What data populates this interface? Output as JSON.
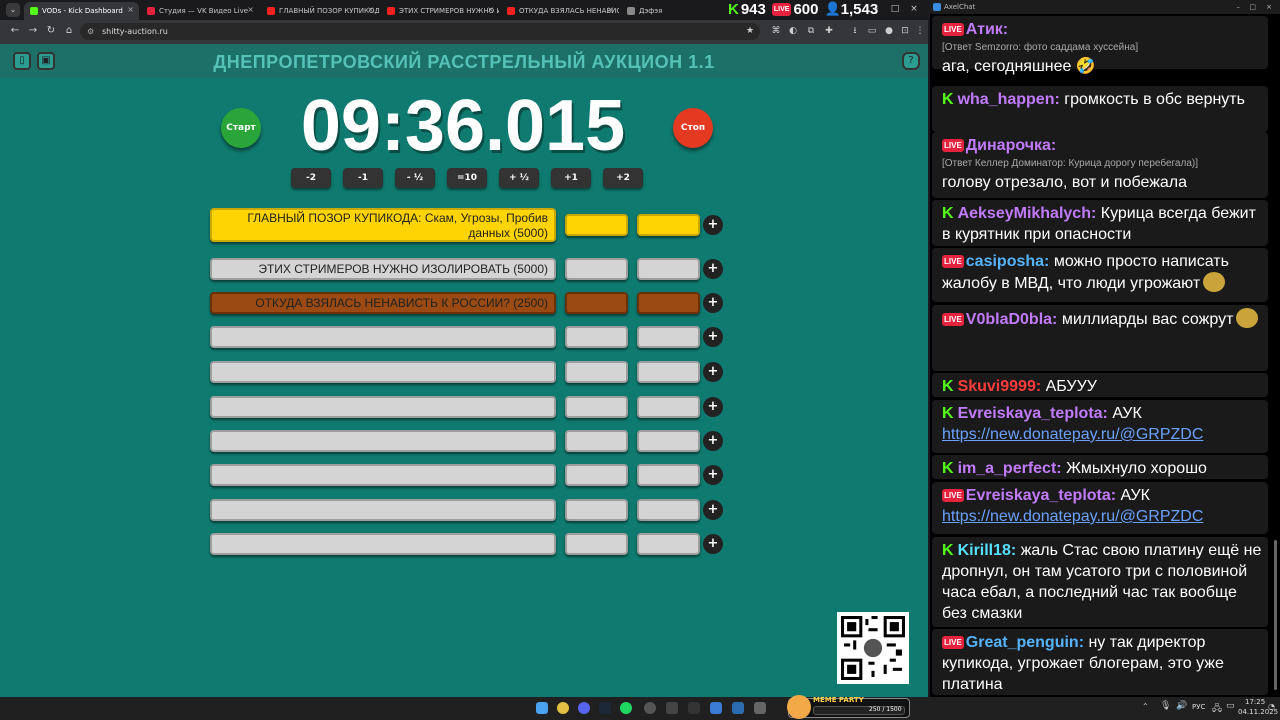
{
  "browser": {
    "tabs": [
      {
        "label": "VODs - Kick Dashboard",
        "color": "#53fc18"
      },
      {
        "label": "Студия — VK Видео Live",
        "color": "#e5233e"
      },
      {
        "label": "ГЛАВНЫЙ ПОЗОР КУПИКОДА: Ск",
        "color": "#ff2020"
      },
      {
        "label": "ЭТИХ СТРИМЕРОВ НУЖНО ИЗ",
        "color": "#ff2020"
      },
      {
        "label": "ОТКУДА ВЗЯЛАСЬ НЕНАВИСТЬ",
        "color": "#ff2020"
      },
      {
        "label": "Дэфэя",
        "color": "#888888"
      }
    ],
    "url": "shitty-auction.ru"
  },
  "overlay": {
    "kick_count": "943",
    "vk_count": "600",
    "viewers": "1,543",
    "vk_badge": "LIVE"
  },
  "auction": {
    "title": "ДНЕПРОПЕТРОВСКИЙ РАССТРЕЛЬНЫЙ АУКЦИОН 1.1",
    "timer": "09:36.015",
    "start_label": "Старт",
    "stop_label": "Стоп",
    "adjust_buttons": [
      "-2",
      "-1",
      "- ½",
      "=10",
      "+ ½",
      "+1",
      "+2"
    ],
    "lots": [
      {
        "text": "ГЛАВНЫЙ ПОЗОР КУПИКОДА: Скам, Угрозы, Пробив данных (5000)",
        "color": "#ffd400"
      },
      {
        "text": "ЭТИХ СТРИМЕРОВ НУЖНО ИЗОЛИРОВАТЬ (5000)",
        "color": "#d4d4d4"
      },
      {
        "text": "ОТКУДА ВЗЯЛАСЬ НЕНАВИСТЬ К РОССИИ? (2500)",
        "color": "#9a4a12"
      },
      {
        "text": "",
        "color": "#d4d4d4"
      },
      {
        "text": "",
        "color": "#d4d4d4"
      },
      {
        "text": "",
        "color": "#d4d4d4"
      },
      {
        "text": "",
        "color": "#d4d4d4"
      },
      {
        "text": "",
        "color": "#d4d4d4"
      },
      {
        "text": "",
        "color": "#d4d4d4"
      },
      {
        "text": "",
        "color": "#d4d4d4"
      }
    ],
    "plus_label": "+"
  },
  "chat": {
    "title": "AxelChat",
    "messages": [
      {
        "platform": "vk",
        "name": "Атик:",
        "color": "#c27bff",
        "reply": "[Ответ Semzorro: фото саддама хуссейна]",
        "text": "ага, сегодняшнее 🤣"
      },
      {
        "platform": "kick",
        "name": "wha_happen:",
        "color": "#c27bff",
        "text": "громкость в обс вернуть"
      },
      {
        "platform": "vk",
        "name": "Динарочка:",
        "color": "#c27bff",
        "reply": "[Ответ Келлер Доминатор: Курица дорогу перебегала)]",
        "text": "голову отрезало, вот и побежала"
      },
      {
        "platform": "kick",
        "name": "AekseyMikhalych:",
        "color": "#c27bff",
        "text": "Курица всегда бежит в курятник при опасности"
      },
      {
        "platform": "vk",
        "name": "casiposha:",
        "color": "#55b3ff",
        "text": "можно просто написать жалобу в МВД, что люди угрожают"
      },
      {
        "platform": "vk",
        "name": "V0blaD0bla:",
        "color": "#c27bff",
        "text": "миллиарды вас сожрут"
      },
      {
        "platform": "kick",
        "name": "Skuvi9999:",
        "color": "#ff3b3b",
        "text": "АБУУУ"
      },
      {
        "platform": "kick",
        "name": "Evreiskaya_teplota:",
        "color": "#c27bff",
        "text": "АУК",
        "link": "https://new.donatepay.ru/@GRPZDC"
      },
      {
        "platform": "kick",
        "name": "im_a_perfect:",
        "color": "#c27bff",
        "text": "Жмыхнуло хорошо"
      },
      {
        "platform": "vk",
        "name": "Evreiskaya_teplota:",
        "color": "#c27bff",
        "text": "АУК",
        "link": "https://new.donatepay.ru/@GRPZDC"
      },
      {
        "platform": "kick",
        "name": "Kirill18:",
        "color": "#55e0ff",
        "text": "жаль Стас свою платину ещё не дропнул, он там усатого три с половиной часа ебал, а последний час так вообще без смазки"
      },
      {
        "platform": "vk",
        "name": "Great_penguin:",
        "color": "#55b3ff",
        "text": "ну так директор купикода, угрожает блогерам, это уже платина"
      }
    ]
  },
  "taskbar": {
    "lang": "РУС",
    "time": "17:25",
    "date": "04.11.2025",
    "widget_label": "MEME PARTY",
    "widget_value": "250 / 1500"
  }
}
